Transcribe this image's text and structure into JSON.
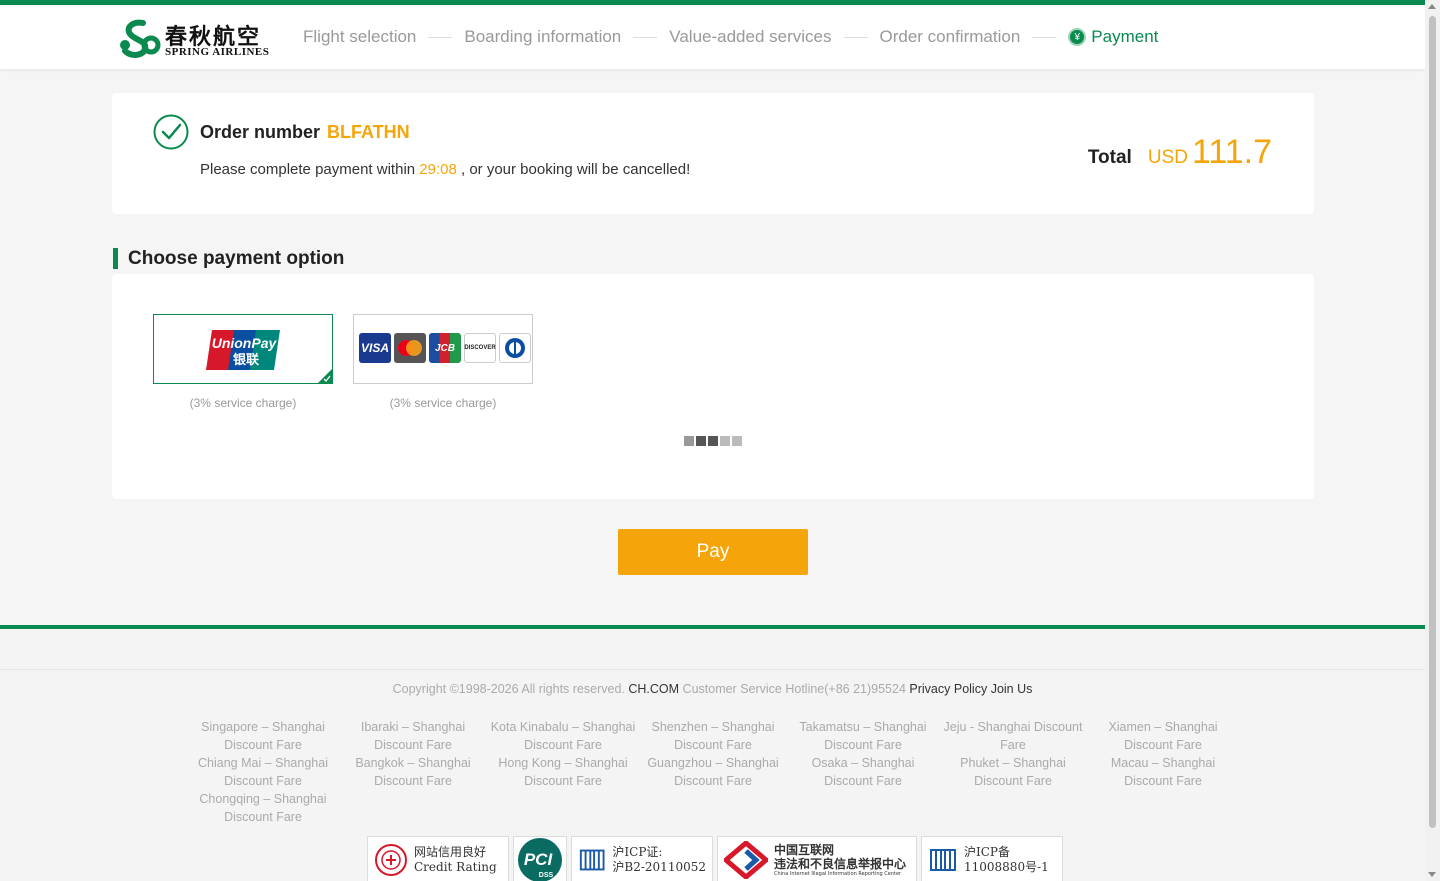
{
  "brand": {
    "name_cn": "春秋航空",
    "name_en": "SPRING AIRLINES",
    "color": "#0a8a4e",
    "accent": "#f5a50a"
  },
  "steps": [
    {
      "label": "Flight selection",
      "active": false
    },
    {
      "label": "Boarding information",
      "active": false
    },
    {
      "label": "Value-added services",
      "active": false
    },
    {
      "label": "Order confirmation",
      "active": false
    },
    {
      "label": "Payment",
      "active": true,
      "icon": "yen-icon"
    }
  ],
  "order": {
    "label": "Order number",
    "number": "BLFATHN",
    "msg_before": "Please complete payment within ",
    "countdown": "29:08",
    "msg_after": " , or your booking will be cancelled!",
    "total_label": "Total",
    "currency": "USD",
    "amount": "111.7"
  },
  "payment": {
    "title": "Choose payment option",
    "options": [
      {
        "name": "UnionPay",
        "logo_text": "UnionPay",
        "logo_cn": "银联",
        "note": "(3% service charge)",
        "selected": true
      },
      {
        "name": "International cards",
        "cards": [
          "VISA",
          "",
          "JCB",
          "DISCOVER",
          ""
        ],
        "note": "(3% service charge)",
        "selected": false
      }
    ],
    "pay_button": "Pay"
  },
  "footer": {
    "copyright": "Copyright ©1998-2026 All rights reserved. ",
    "site": "CH.COM",
    "hotline": " Customer Service Hotline(+86 21)95524 ",
    "privacy": "Privacy Policy",
    "join": "Join Us",
    "links": [
      "Singapore – Shanghai Discount Fare",
      "Ibaraki – Shanghai Discount Fare",
      "Kota Kinabalu – Shanghai Discount Fare",
      "Shenzhen – Shanghai Discount Fare",
      "Takamatsu – Shanghai Discount Fare",
      "Jeju - Shanghai Discount Fare",
      "Xiamen – Shanghai Discount Fare",
      "Chiang Mai – Shanghai Discount Fare",
      "Bangkok – Shanghai Discount Fare",
      "Hong Kong – Shanghai Discount Fare",
      "Guangzhou – Shanghai Discount Fare",
      "Osaka – Shanghai Discount Fare",
      "Phuket – Shanghai Discount Fare",
      "Macau – Shanghai Discount Fare",
      "Chongqing – Shanghai Discount Fare"
    ],
    "badges": {
      "credit_cn": "网站信用良好",
      "credit_en": "Credit Rating",
      "pci": "PCI",
      "pci_sub": "DSS",
      "icp1_a": "沪ICP证:",
      "icp1_b": "沪B2-20110052",
      "report_a": "中国互联网",
      "report_b": "违法和不良信息举报中心",
      "report_c": "China Internet Illegal Information Reporting Center",
      "icp2_a": "沪ICP备",
      "icp2_b": "11008880号-1"
    }
  }
}
